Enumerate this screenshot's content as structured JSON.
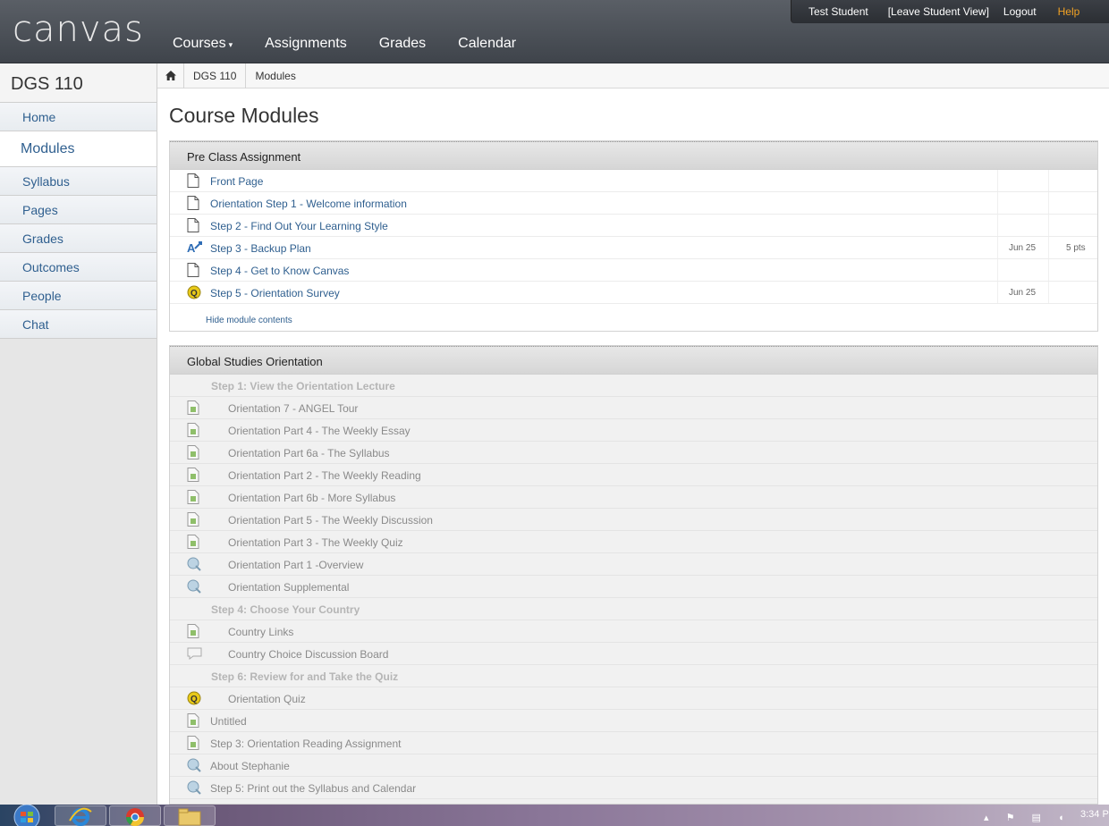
{
  "header": {
    "logo": "canvas",
    "nav": [
      {
        "label": "Courses",
        "caret": "▾"
      },
      {
        "label": "Assignments"
      },
      {
        "label": "Grades"
      },
      {
        "label": "Calendar"
      }
    ],
    "topbar": {
      "user": "Test Student",
      "leave": "[Leave Student View]",
      "logout": "Logout",
      "help": "Help"
    }
  },
  "sidebar": {
    "course": "DGS 110",
    "items": [
      "Home",
      "Modules",
      "Syllabus",
      "Pages",
      "Grades",
      "Outcomes",
      "People",
      "Chat"
    ],
    "active": "Modules"
  },
  "breadcrumb": {
    "home_icon": "home-icon",
    "items": [
      "DGS 110",
      "Modules"
    ]
  },
  "page_title": "Course Modules",
  "modules": [
    {
      "title": "Pre Class Assignment",
      "items": [
        {
          "icon": "page-icon",
          "label": "Front Page",
          "date": "",
          "pts": ""
        },
        {
          "icon": "page-icon",
          "label": "Orientation Step 1 - Welcome information",
          "date": "",
          "pts": ""
        },
        {
          "icon": "page-icon",
          "label": "Step 2 - Find Out Your Learning Style",
          "date": "",
          "pts": ""
        },
        {
          "icon": "assignment-icon",
          "label": "Step 3 - Backup Plan",
          "date": "Jun 25",
          "pts": "5 pts"
        },
        {
          "icon": "page-icon",
          "label": "Step 4 - Get to Know Canvas",
          "date": "",
          "pts": ""
        },
        {
          "icon": "quiz-icon",
          "label": "Step 5 - Orientation Survey",
          "date": "Jun 25",
          "pts": ""
        }
      ],
      "hide_link": "Hide module contents"
    },
    {
      "title": "Global Studies Orientation",
      "items": [
        {
          "type": "head",
          "icon": "",
          "label": "Step 1: View the Orientation Lecture"
        },
        {
          "type": "sub",
          "icon": "file-icon",
          "label": "Orientation 7 - ANGEL Tour"
        },
        {
          "type": "sub",
          "icon": "file-icon",
          "label": "Orientation Part 4 - The Weekly Essay"
        },
        {
          "type": "sub",
          "icon": "file-icon",
          "label": "Orientation Part 6a - The Syllabus"
        },
        {
          "type": "sub",
          "icon": "file-icon",
          "label": "Orientation Part 2 - The Weekly Reading"
        },
        {
          "type": "sub",
          "icon": "file-icon",
          "label": "Orientation Part 6b - More Syllabus"
        },
        {
          "type": "sub",
          "icon": "file-icon",
          "label": "Orientation Part 5 - The Weekly Discussion"
        },
        {
          "type": "sub",
          "icon": "file-icon",
          "label": "Orientation Part 3 - The Weekly Quiz"
        },
        {
          "type": "sub",
          "icon": "link-icon",
          "label": "Orientation Part 1 -Overview"
        },
        {
          "type": "sub",
          "icon": "link-icon",
          "label": "Orientation Supplemental"
        },
        {
          "type": "head",
          "icon": "",
          "label": "Step 4: Choose Your Country"
        },
        {
          "type": "sub",
          "icon": "file-icon",
          "label": "Country Links"
        },
        {
          "type": "sub",
          "icon": "discussion-icon",
          "label": "Country Choice Discussion Board"
        },
        {
          "type": "head",
          "icon": "",
          "label": "Step 6: Review for and Take the Quiz"
        },
        {
          "type": "sub",
          "icon": "quiz-icon",
          "label": "Orientation Quiz"
        },
        {
          "type": "item",
          "icon": "file-icon",
          "label": "Untitled"
        },
        {
          "type": "item",
          "icon": "file-icon",
          "label": "Step 3: Orientation Reading Assignment"
        },
        {
          "type": "item",
          "icon": "link-icon",
          "label": "About Stephanie"
        },
        {
          "type": "item",
          "icon": "link-icon",
          "label": "Step 5: Print out the Syllabus and Calendar"
        }
      ]
    }
  ],
  "taskbar": {
    "clock": "3:34 P"
  }
}
